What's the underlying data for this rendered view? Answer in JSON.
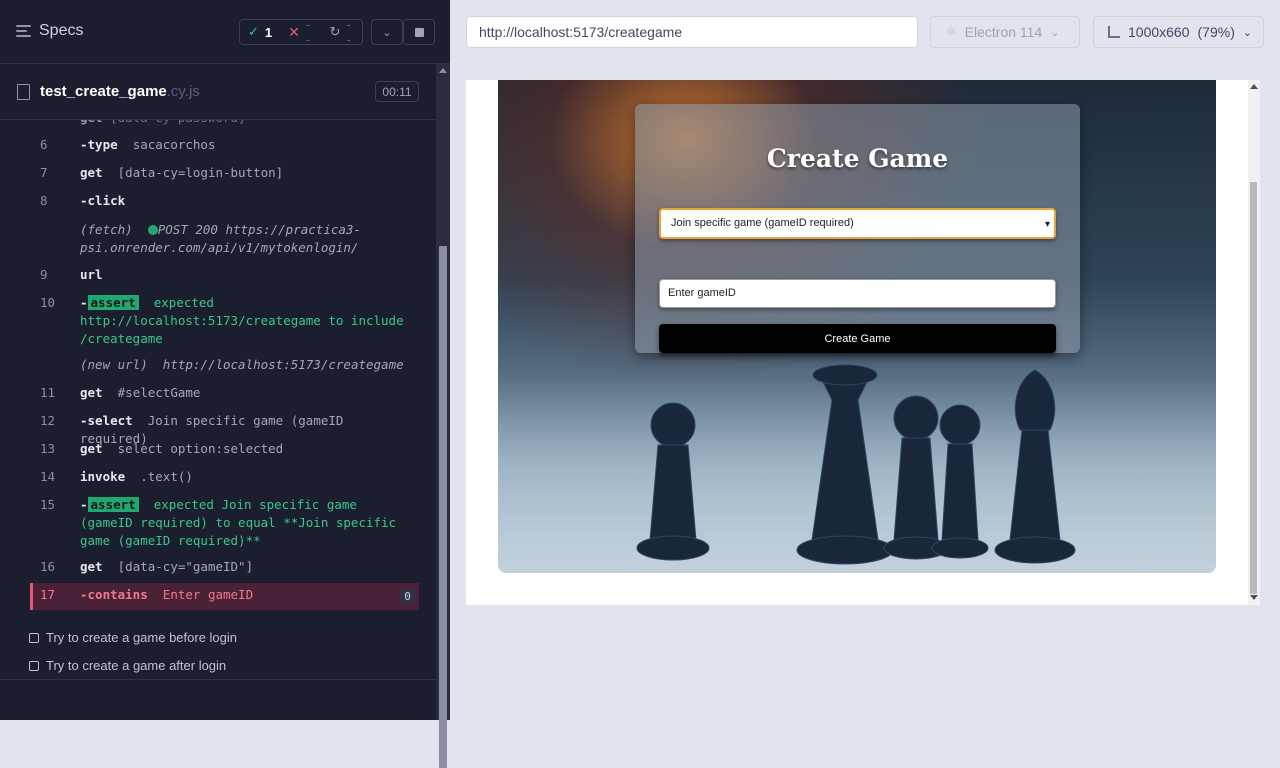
{
  "reporter": {
    "title": "Specs",
    "stats": {
      "passed": "1",
      "failed": "--",
      "pending": "--"
    },
    "spec": {
      "name": "test_create_game",
      "ext": ".cy.js",
      "duration": "00:11"
    },
    "commands": [
      {
        "num": "6",
        "name": "-type",
        "message": "sacacorchos"
      },
      {
        "num": "7",
        "name": "get",
        "message": "[data-cy=login-button]"
      },
      {
        "num": "8",
        "name": "-click",
        "message": ""
      },
      {
        "num": "",
        "name": "(fetch)",
        "message": "POST 200 https://practica3-psi.onrender.com/api/v1/mytokenlogin/"
      },
      {
        "num": "9",
        "name": "url",
        "message": ""
      },
      {
        "num": "10",
        "name": "-",
        "badge": "assert",
        "message": "expected http://localhost:5173/creategame to include /creategame"
      },
      {
        "num": "",
        "name": "(new url)",
        "message": "http://localhost:5173/creategame"
      },
      {
        "num": "11",
        "name": "get",
        "message": "#selectGame"
      },
      {
        "num": "12",
        "name": "-select",
        "message": "Join specific game (gameID required)"
      },
      {
        "num": "13",
        "name": "get",
        "message": "select option:selected"
      },
      {
        "num": "14",
        "name": "invoke",
        "message": ".text()"
      },
      {
        "num": "15",
        "name": "-",
        "badge": "assert",
        "message": "expected Join specific game (gameID required) to equal **Join specific game (gameID required)**"
      },
      {
        "num": "16",
        "name": "get",
        "message": "[data-cy=\"gameID\"]"
      },
      {
        "num": "17",
        "name": "-contains",
        "message": "Enter gameID",
        "count": "0"
      }
    ],
    "partial_line": "get [data-cy=password]",
    "tests": [
      "Try to create a game before login",
      "Try to create a game after login"
    ]
  },
  "aut": {
    "url": "http://localhost:5173/creategame",
    "browser": "Electron 114",
    "viewport": "1000x660",
    "scale": "(79%)",
    "page": {
      "title": "Create Game",
      "select_value": "Join specific game (gameID required)",
      "input_placeholder": "Enter gameID",
      "button_label": "Create Game"
    }
  },
  "colors": {
    "pass": "#1fa971",
    "fail": "#e45770",
    "panel_bg": "#1b1e2e"
  }
}
